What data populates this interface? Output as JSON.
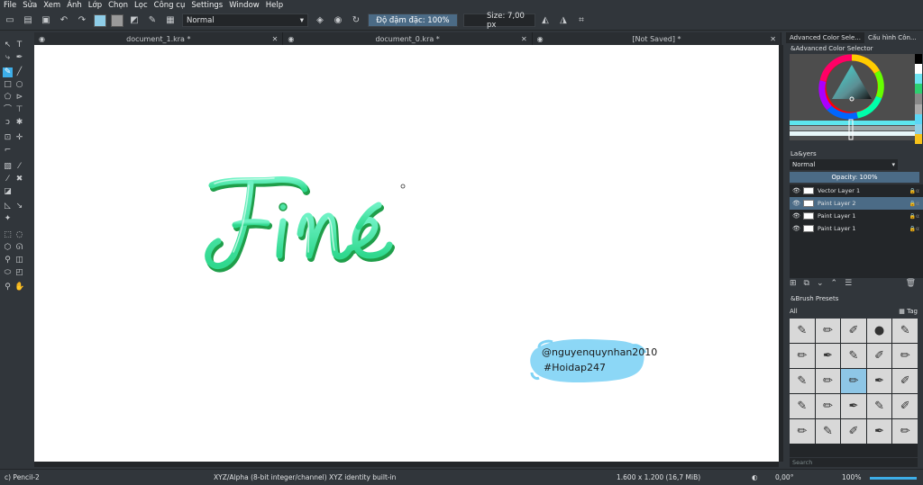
{
  "menu": [
    "File",
    "Sửa",
    "Xem",
    "Ảnh",
    "Lớp",
    "Chọn",
    "Lọc",
    "Công cụ",
    "Settings",
    "Window",
    "Help"
  ],
  "toolbar": {
    "blend_mode": "Normal",
    "opacity_label": "Độ đậm đặc: 100%",
    "size_label": "Size: 7,00 px"
  },
  "tabs": [
    "document_1.kra *",
    "document_0.kra *",
    "[Not Saved]  *"
  ],
  "canvas": {
    "word": "Fine",
    "watermark_line1": "@nguyenquynhan2010",
    "watermark_line2": "#Hoidap247"
  },
  "dock": {
    "tab_1": "Advanced Color Sele...",
    "tab_2": "Cấu hình Côn...",
    "color_panel_title": "&Advanced Color Selector",
    "layers_title": "La&yers",
    "layers_blend": "Normal",
    "layers_opacity": "Opacity:  100%",
    "layers": [
      {
        "name": "Vector Layer 1",
        "selected": false
      },
      {
        "name": "Paint Layer 2",
        "selected": true
      },
      {
        "name": "Paint Layer 1",
        "selected": false
      },
      {
        "name": "Paint Layer 1",
        "selected": false
      }
    ],
    "brush_title": "&Brush Presets",
    "brush_filter": "All",
    "brush_tag": "Tag",
    "brush_search": "Search"
  },
  "status": {
    "tool": "c) Pencil-2",
    "colorspace": "XYZ/Alpha (8-bit integer/channel)  XYZ identity built-in",
    "dimensions": "1.600 x 1.200 (16,7 MiB)",
    "rotation": "0,00°",
    "zoom": "100%"
  },
  "colors": {
    "accent": "#3daee9",
    "selection": "#4b6b86",
    "background": "#31363b",
    "canvas": "#ffffff",
    "lettering": "#3ddc97",
    "watermark_blob": "#7fd3f5"
  }
}
